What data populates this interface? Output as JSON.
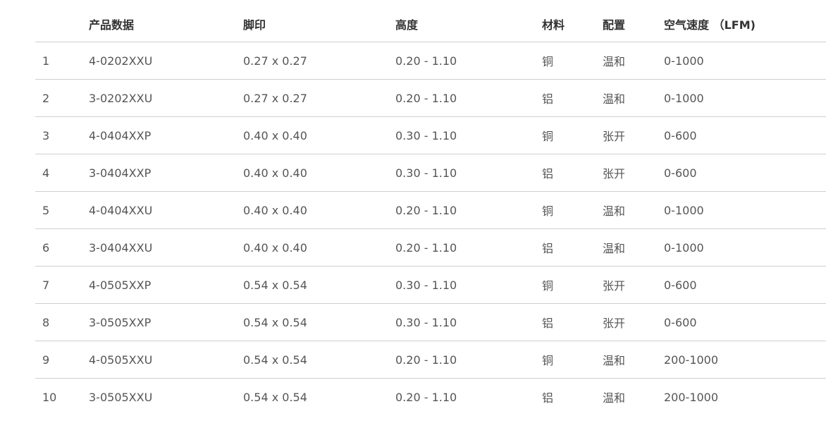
{
  "table": {
    "headers": [
      "",
      "产品数据",
      "脚印",
      "高度",
      "材料",
      "配置",
      "空气速度 （LFM)"
    ],
    "rows": [
      [
        "1",
        "4-0202XXU",
        "0.27 x 0.27",
        "0.20 - 1.10",
        "铜",
        "温和",
        "0-1000"
      ],
      [
        "2",
        "3-0202XXU",
        "0.27 x 0.27",
        "0.20 - 1.10",
        "铝",
        "温和",
        "0-1000"
      ],
      [
        "3",
        "4-0404XXP",
        "0.40 x 0.40",
        "0.30 - 1.10",
        "铜",
        "张开",
        "0-600"
      ],
      [
        "4",
        "3-0404XXP",
        "0.40 x 0.40",
        "0.30 - 1.10",
        "铝",
        "张开",
        "0-600"
      ],
      [
        "5",
        "4-0404XXU",
        "0.40 x 0.40",
        "0.20 - 1.10",
        "铜",
        "温和",
        "0-1000"
      ],
      [
        "6",
        "3-0404XXU",
        "0.40 x 0.40",
        "0.20 - 1.10",
        "铝",
        "温和",
        "0-1000"
      ],
      [
        "7",
        "4-0505XXP",
        "0.54 x 0.54",
        "0.30 - 1.10",
        "铜",
        "张开",
        "0-600"
      ],
      [
        "8",
        "3-0505XXP",
        "0.54 x 0.54",
        "0.30 - 1.10",
        "铝",
        "张开",
        "0-600"
      ],
      [
        "9",
        "4-0505XXU",
        "0.54 x 0.54",
        "0.20 - 1.10",
        "铜",
        "温和",
        "200-1000"
      ],
      [
        "10",
        "3-0505XXU",
        "0.54 x 0.54",
        "0.20 - 1.10",
        "铝",
        "温和",
        "200-1000"
      ]
    ]
  }
}
